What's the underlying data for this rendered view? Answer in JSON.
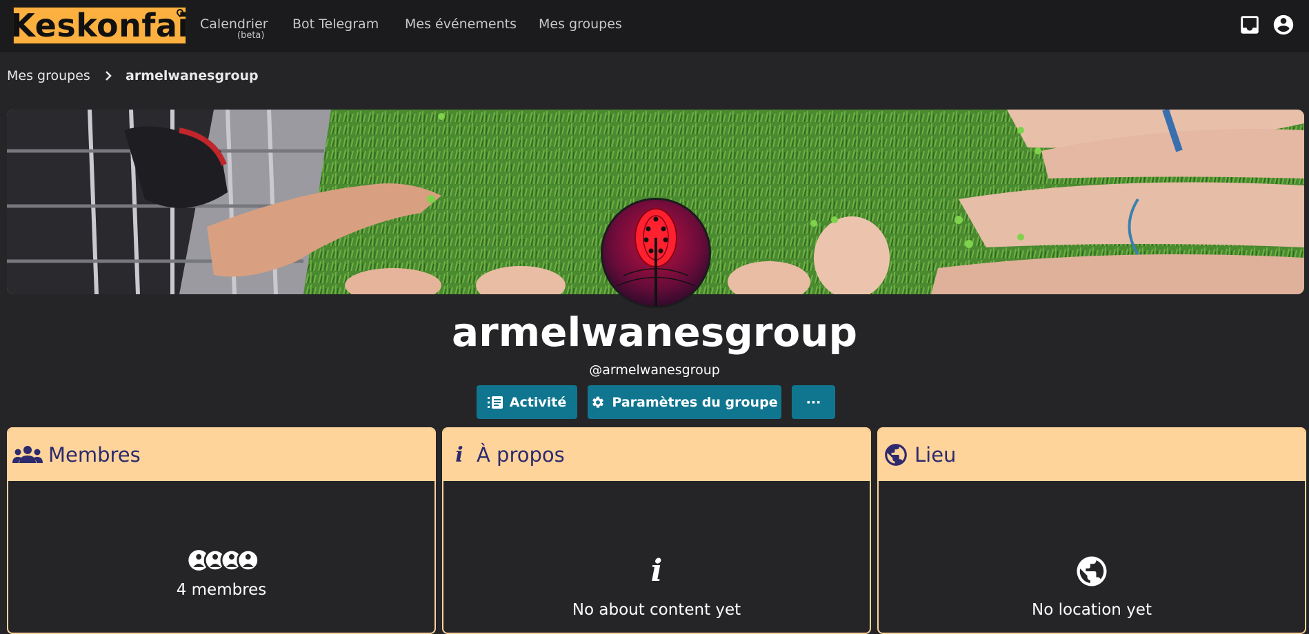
{
  "navbar": {
    "logo_text": "Keskonfai",
    "items": [
      {
        "label": "Calendrier",
        "sub": "(beta)"
      },
      {
        "label": "Bot Telegram"
      },
      {
        "label": "Mes événements"
      },
      {
        "label": "Mes groupes"
      }
    ],
    "icons": [
      "inbox-icon",
      "account-circle-icon"
    ]
  },
  "breadcrumb": {
    "parent": "Mes groupes",
    "current": "armelwanesgroup"
  },
  "group": {
    "title": "armelwanesgroup",
    "handle": "@armelwanesgroup"
  },
  "actions": {
    "activity": "Activité",
    "settings": "Paramètres du groupe",
    "more": "···"
  },
  "cards": {
    "members": {
      "title": "Membres",
      "text": "4 membres",
      "count": 4
    },
    "about": {
      "title": "À propos",
      "text": "No about content yet"
    },
    "location": {
      "title": "Lieu",
      "text": "No location yet"
    }
  },
  "colors": {
    "accent_button": "#10768f",
    "card_header": "#ffd49b",
    "card_title": "#2d2a6e",
    "logo_bg": "#fbb040"
  }
}
